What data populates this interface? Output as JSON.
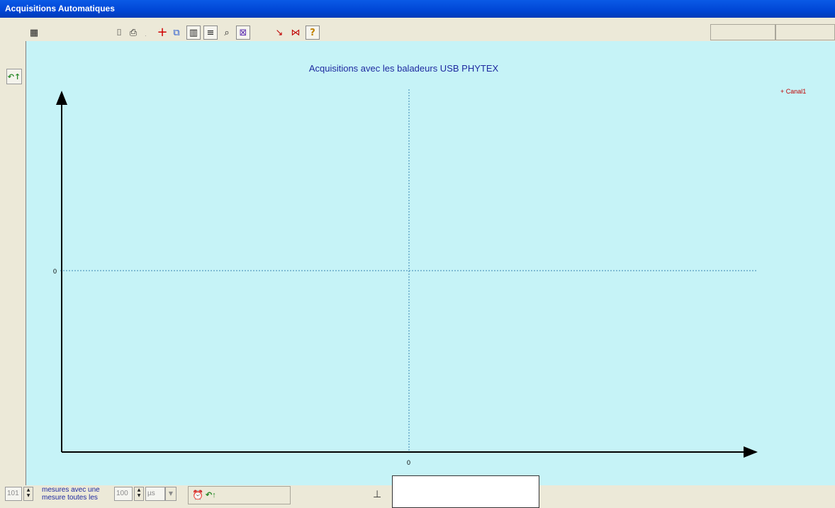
{
  "window": {
    "title": "Acquisitions Automatiques"
  },
  "toolbar": {
    "buttons": [
      {
        "name": "table-icon",
        "glyph": "▦"
      },
      {
        "name": "camera-icon",
        "glyph": "⌷"
      },
      {
        "name": "print-icon",
        "glyph": "⎙"
      },
      {
        "name": "crosshair-icon",
        "glyph": "+"
      },
      {
        "name": "copy-icon",
        "glyph": "⧉"
      },
      {
        "name": "vertical-lines-icon",
        "glyph": "▥"
      },
      {
        "name": "horizontal-lines-icon",
        "glyph": "≡"
      },
      {
        "name": "zoom-icon",
        "glyph": "🔍"
      },
      {
        "name": "scale-icon",
        "glyph": "⊠"
      },
      {
        "name": "tangent-icon",
        "glyph": "↘"
      },
      {
        "name": "interval-icon",
        "glyph": "⋈"
      },
      {
        "name": "help-icon",
        "glyph": "?"
      }
    ]
  },
  "chart_data": {
    "type": "line",
    "title": "Acquisitions avec les baladeurs USB PHYTEX",
    "series": [
      {
        "name": "Canal1",
        "values": []
      }
    ],
    "x_tick_labels": [
      "0"
    ],
    "y_tick_labels": [
      "0"
    ],
    "legend_position": "top-right",
    "colors": {
      "series": "#c00000",
      "axes": "#000000",
      "zero_lines": "#3a86b0",
      "background": "#c6f3f7"
    }
  },
  "statusbar": {
    "count_value": "101",
    "label_line1": "mesures avec une",
    "label_line2": "mesure toutes les",
    "interval_value": "100",
    "unit_value": "µs"
  }
}
